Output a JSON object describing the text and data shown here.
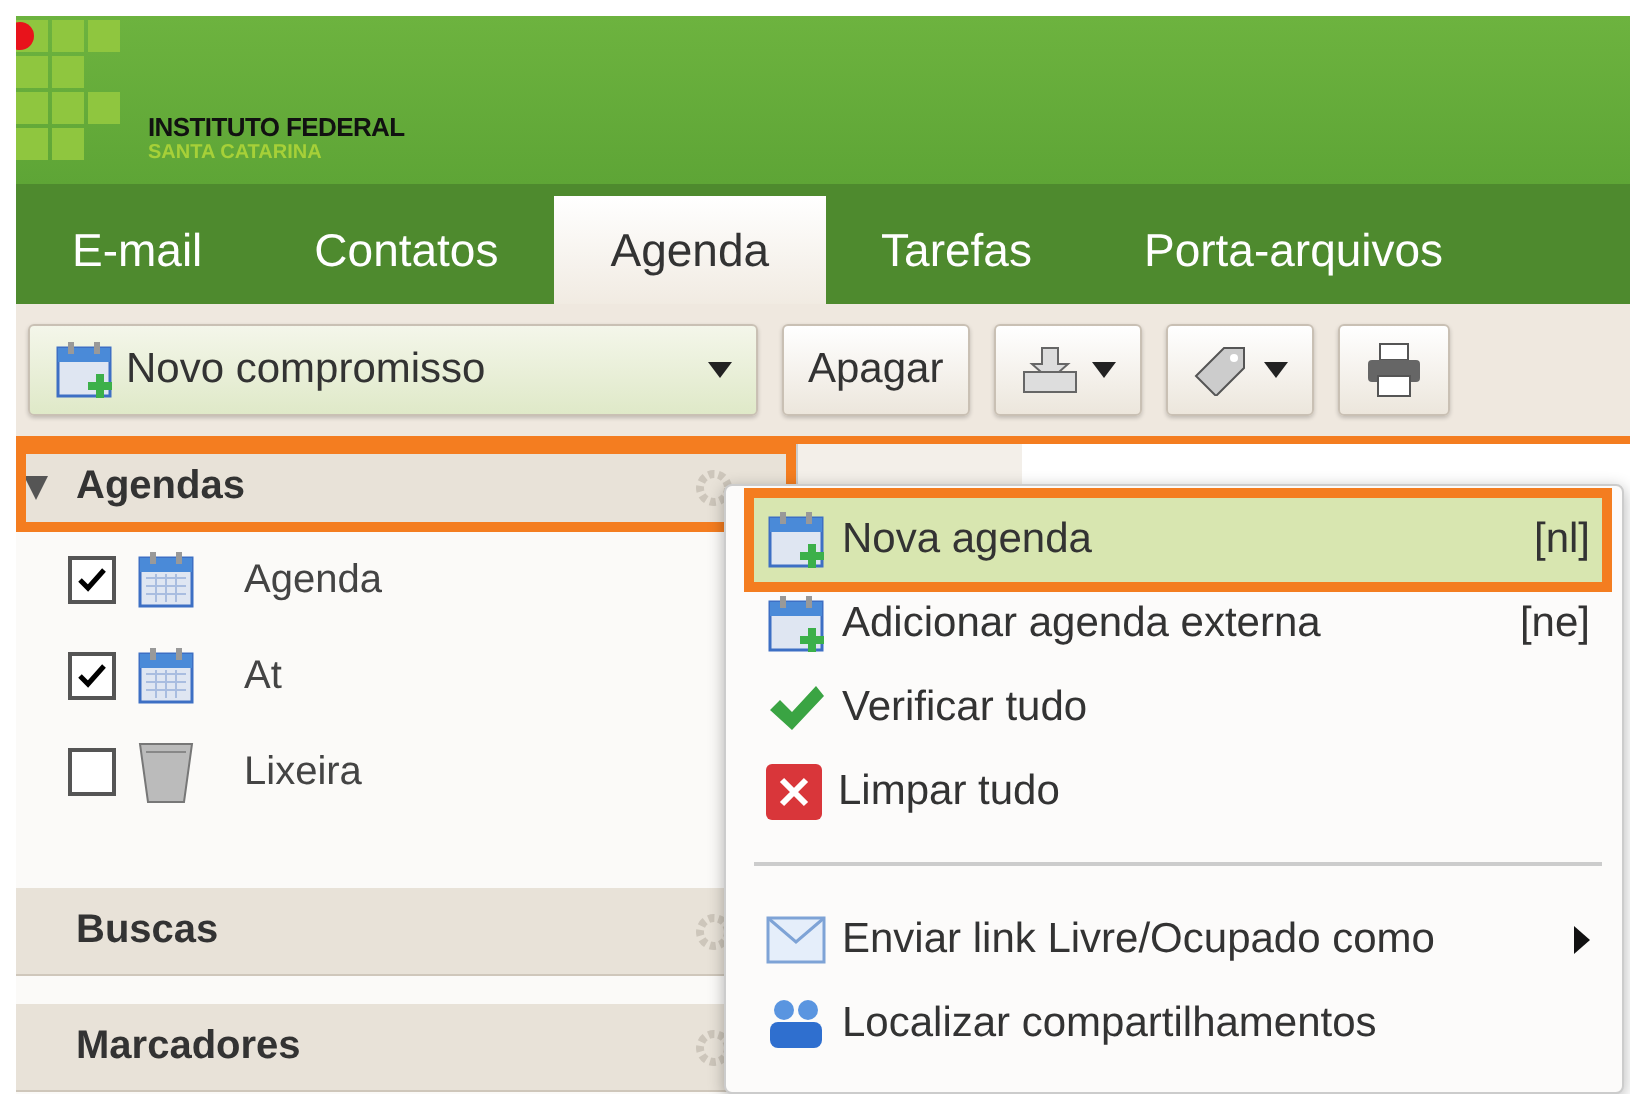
{
  "header": {
    "org_name": "INSTITUTO FEDERAL",
    "org_sub": "SANTA CATARINA"
  },
  "tabs": [
    {
      "label": "E-mail",
      "selected": false
    },
    {
      "label": "Contatos",
      "selected": false
    },
    {
      "label": "Agenda",
      "selected": true
    },
    {
      "label": "Tarefas",
      "selected": false
    },
    {
      "label": "Porta-arquivos",
      "selected": false
    }
  ],
  "toolbar": {
    "new_button": "Novo compromisso",
    "delete_button": "Apagar"
  },
  "sidebar": {
    "sections": [
      {
        "title": "Agendas",
        "expanded": true,
        "highlighted": true,
        "items": [
          {
            "label": "Agenda",
            "checked": true,
            "kind": "calendar"
          },
          {
            "label": "At",
            "checked": true,
            "kind": "calendar"
          },
          {
            "label": "Lixeira",
            "checked": false,
            "kind": "trash"
          }
        ]
      },
      {
        "title": "Buscas",
        "expanded": false,
        "highlighted": false
      },
      {
        "title": "Marcadores",
        "expanded": false,
        "highlighted": false
      }
    ]
  },
  "context_menu": [
    {
      "kind": "item",
      "label": "Nova agenda",
      "shortcut": "[nl]",
      "selected": true,
      "highlighted": true
    },
    {
      "kind": "item",
      "label": "Adicionar agenda externa",
      "shortcut": "[ne]",
      "selected": false,
      "highlighted": false
    },
    {
      "kind": "item",
      "label": "Verificar tudo",
      "selected": false,
      "highlighted": false
    },
    {
      "kind": "item",
      "label": "Limpar tudo",
      "selected": false,
      "highlighted": false
    },
    {
      "kind": "separator"
    },
    {
      "kind": "submenu",
      "label": "Enviar link Livre/Ocupado como",
      "selected": false,
      "highlighted": false
    },
    {
      "kind": "item",
      "label": "Localizar compartilhamentos",
      "selected": false,
      "highlighted": false
    }
  ]
}
